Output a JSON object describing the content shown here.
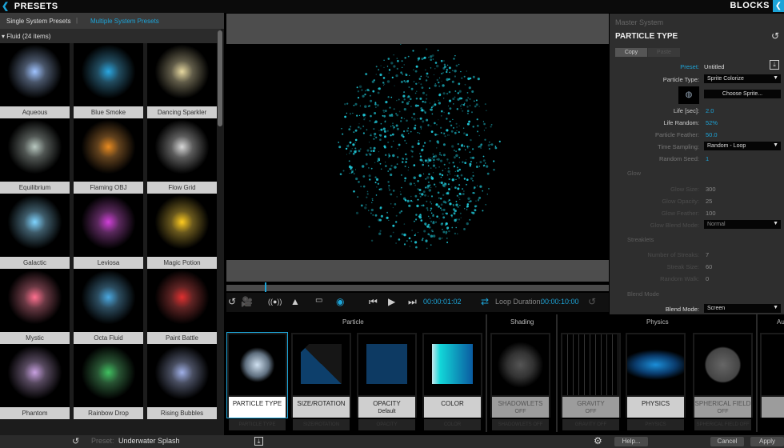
{
  "header": {
    "presets_title": "PRESETS",
    "blocks_title": "BLOCKS"
  },
  "preset_tabs": {
    "single": "Single System Presets",
    "separator": "|",
    "multiple": "Multiple System Presets",
    "active": "multiple"
  },
  "folder": {
    "label": "Fluid (24 items)"
  },
  "presets": [
    {
      "name": "Aqueous",
      "color": "#9fc3ff"
    },
    {
      "name": "Blue Smoke",
      "color": "#2aa6e0"
    },
    {
      "name": "Dancing Sparkler",
      "color": "#e6d8a0"
    },
    {
      "name": "Equilibrium",
      "color": "#b8c8c0"
    },
    {
      "name": "Flaming OBJ",
      "color": "#e88a20"
    },
    {
      "name": "Flow Grid",
      "color": "#d8d8d8"
    },
    {
      "name": "Galactic",
      "color": "#7fd4ff"
    },
    {
      "name": "Leviosa",
      "color": "#d040d8"
    },
    {
      "name": "Magic Potion",
      "color": "#ffcc20"
    },
    {
      "name": "Mystic",
      "color": "#ff7090"
    },
    {
      "name": "Octa Fluid",
      "color": "#4aa8e0"
    },
    {
      "name": "Paint Battle",
      "color": "#e03030"
    },
    {
      "name": "Phantom",
      "color": "#c8a0e0"
    },
    {
      "name": "Rainbow Drop",
      "color": "#40c060"
    },
    {
      "name": "Rising Bubbles",
      "color": "#a0b0e8"
    }
  ],
  "viewer": {
    "particle_color": "#1fc8d8"
  },
  "transport": {
    "timecode": "00:00:01:02",
    "loop_label": "Loop Duration:",
    "loop_duration": "00:00:10:00",
    "playhead_fraction": 0.1
  },
  "right_panel": {
    "context": "Master System",
    "title": "PARTICLE TYPE",
    "copy_label": "Copy",
    "paste_label": "Paste",
    "preset_label": "Preset:",
    "preset_value": "Untitled",
    "particle_type_label": "Particle Type:",
    "particle_type_value": "Sprite Colorize",
    "choose_sprite_label": "Choose Sprite...",
    "life_label": "Life [sec]:",
    "life_value": "2.0",
    "life_random_label": "Life Random:",
    "life_random_value": "52%",
    "feather_label": "Particle Feather:",
    "feather_value": "50.0",
    "time_sampling_label": "Time Sampling:",
    "time_sampling_value": "Random - Loop",
    "seed_label": "Random Seed:",
    "seed_value": "1",
    "glow_section": "Glow",
    "glow_size_label": "Glow Size:",
    "glow_size_value": "300",
    "glow_opacity_label": "Glow Opacity:",
    "glow_opacity_value": "25",
    "glow_feather_label": "Glow Feather:",
    "glow_feather_value": "100",
    "glow_blend_label": "Glow Blend Mode:",
    "glow_blend_value": "Normal",
    "streaklets_section": "Streaklets",
    "num_streaks_label": "Number of Streaks:",
    "num_streaks_value": "7",
    "streak_size_label": "Streak Size:",
    "streak_size_value": "60",
    "random_walk_label": "Random Walk:",
    "random_walk_value": "0",
    "blend_section": "Blend Mode",
    "blend_mode_label": "Blend Mode:",
    "blend_mode_value": "Screen"
  },
  "module_groups": [
    {
      "label": "Particle",
      "active": true
    },
    {
      "label": "Shading"
    },
    {
      "label": "Physics"
    },
    {
      "label": "Au"
    }
  ],
  "modules": [
    {
      "label": "PARTICLE TYPE",
      "sub": "",
      "state": "selected"
    },
    {
      "label": "SIZE/ROTATION",
      "sub": "",
      "state": "on"
    },
    {
      "label": "OPACITY",
      "sub": "Default",
      "state": "on"
    },
    {
      "label": "COLOR",
      "sub": "",
      "state": "on"
    },
    {
      "label": "SHADOWLETS",
      "sub": "OFF",
      "state": "off"
    },
    {
      "label": "GRAVITY",
      "sub": "OFF",
      "state": "off"
    },
    {
      "label": "PHYSICS",
      "sub": "",
      "state": "on"
    },
    {
      "label": "SPHERICAL FIELD",
      "sub": "OFF",
      "state": "off"
    }
  ],
  "module_ghost_labels": [
    "PARTICLE TYPE",
    "SIZE/ROTATION",
    "OPACITY",
    "COLOR",
    "SHADOWLETS OFF",
    "GRAVITY OFF",
    "PHYSICS",
    "SPHERICAL FIELD OFF"
  ],
  "bottom": {
    "preset_label": "Preset:",
    "preset_value": "Underwater Splash",
    "help_label": "Help...",
    "cancel_label": "Cancel",
    "apply_label": "Apply"
  },
  "colors": {
    "accent": "#1ca4d8"
  }
}
